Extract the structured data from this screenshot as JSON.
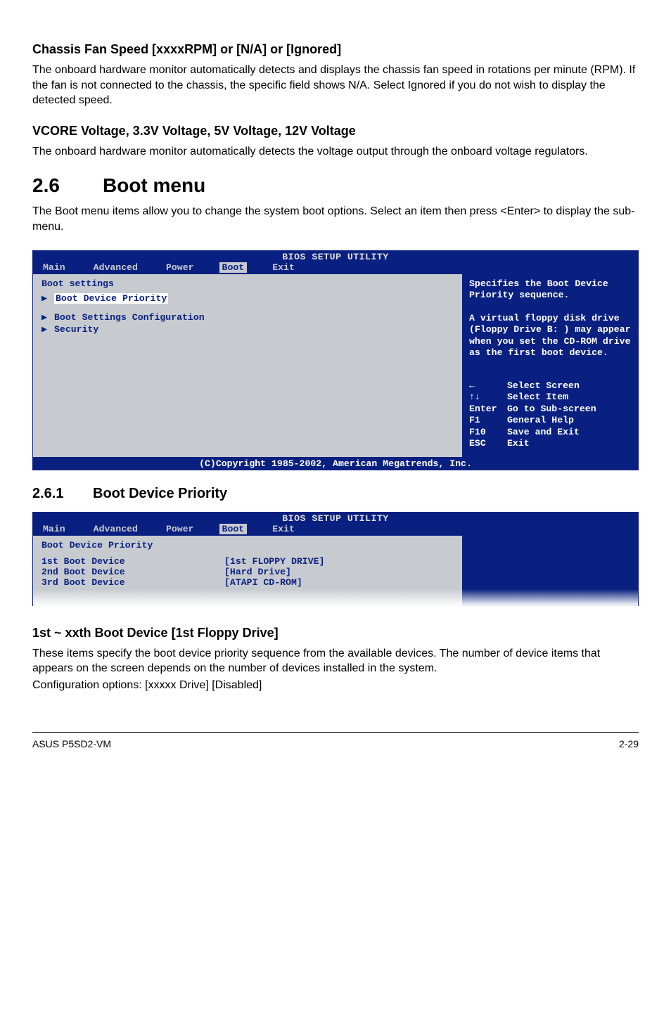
{
  "section_chassis": {
    "heading": "Chassis Fan Speed [xxxxRPM] or [N/A] or [Ignored]",
    "body": "The onboard hardware monitor automatically detects and displays the chassis fan speed in rotations per minute (RPM). If the fan is not connected to the chassis, the specific field shows N/A. Select Ignored if you do not wish to display the detected speed."
  },
  "section_vcore": {
    "heading": "VCORE Voltage, 3.3V Voltage, 5V Voltage, 12V Voltage",
    "body": "The onboard hardware monitor automatically detects the voltage output through the onboard voltage regulators."
  },
  "boot_menu": {
    "num": "2.6",
    "title": "Boot menu",
    "body": "The Boot menu items allow you to change the system boot options. Select an item then press <Enter> to display the sub-menu."
  },
  "bios1": {
    "title": "BIOS SETUP UTILITY",
    "tabs": [
      "Main",
      "Advanced",
      "Power",
      "Boot",
      "Exit"
    ],
    "active_tab": "Boot",
    "heading": "Boot settings",
    "items": [
      {
        "label": "Boot Device Priority",
        "selected": true
      },
      {
        "label": "Boot Settings Configuration",
        "selected": false
      },
      {
        "label": "Security",
        "selected": false
      }
    ],
    "help1": "Specifies the Boot Device Priority sequence.",
    "help2": "A virtual floppy disk drive (Floppy Drive B: ) may appear when you set the CD-ROM drive as the first boot device.",
    "nav": [
      {
        "key": "←",
        "label": "Select Screen"
      },
      {
        "key": "↑↓",
        "label": "Select Item"
      },
      {
        "key": "Enter",
        "label": "Go to Sub-screen"
      },
      {
        "key": "F1",
        "label": "General Help"
      },
      {
        "key": "F10",
        "label": "Save and Exit"
      },
      {
        "key": "ESC",
        "label": "Exit"
      }
    ],
    "footer": "(C)Copyright 1985-2002, American Megatrends, Inc."
  },
  "subsection": {
    "num": "2.6.1",
    "title": "Boot Device Priority"
  },
  "bios2": {
    "title": "BIOS SETUP UTILITY",
    "tabs": [
      "Main",
      "Advanced",
      "Power",
      "Boot",
      "Exit"
    ],
    "active_tab": "Boot",
    "heading": "Boot Device Priority",
    "devices": [
      {
        "label": "1st Boot Device",
        "value": "[1st FLOPPY DRIVE]"
      },
      {
        "label": "2nd Boot Device",
        "value": "[Hard Drive]"
      },
      {
        "label": "3rd Boot Device",
        "value": "[ATAPI CD-ROM]"
      }
    ]
  },
  "section_1stxxth": {
    "heading": "1st ~ xxth Boot Device [1st Floppy Drive]",
    "body1": "These items specify the boot device priority sequence from the available devices. The number of device items that appears on the screen depends on the number of devices installed in the system.",
    "body2": "Configuration options: [xxxxx Drive] [Disabled]"
  },
  "footer": {
    "left": "ASUS P5SD2-VM",
    "right": "2-29"
  }
}
